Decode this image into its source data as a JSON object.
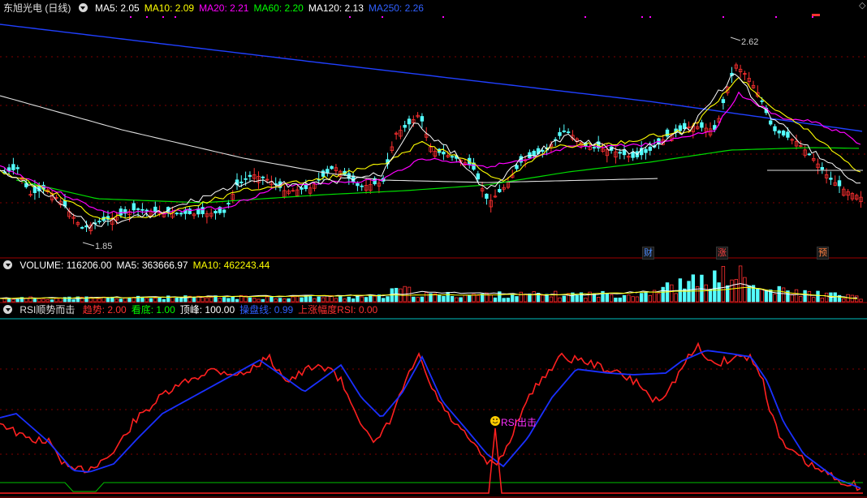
{
  "main_panel": {
    "stock_title": "东旭光电 (日线)",
    "indicators": [
      {
        "label": "MA5: 2.05",
        "color": "#ffffff"
      },
      {
        "label": "MA10: 2.09",
        "color": "#ffff00"
      },
      {
        "label": "MA20: 2.21",
        "color": "#ff00ff"
      },
      {
        "label": "MA60: 2.20",
        "color": "#00ff00"
      },
      {
        "label": "MA120: 2.13",
        "color": "#ffffff"
      },
      {
        "label": "MA250: 2.26",
        "color": "#3060ff"
      }
    ],
    "high_label": "2.62",
    "low_label": "1.85",
    "event_tags": [
      {
        "text": "财",
        "color": "#4a8cff"
      },
      {
        "text": "涨",
        "color": "#ff4040"
      },
      {
        "text": "预",
        "color": "#ff8040"
      }
    ]
  },
  "volume_panel": {
    "indicators": [
      {
        "label": "VOLUME: 116206.00",
        "color": "#ffffff"
      },
      {
        "label": "MA5: 363666.97",
        "color": "#ffffff"
      },
      {
        "label": "MA10: 462243.44",
        "color": "#ffff00"
      }
    ]
  },
  "rsi_panel": {
    "name": "RSI顺势而击",
    "indicators": [
      {
        "label": "趋势: 2.00",
        "color": "#ff3030"
      },
      {
        "label": "看底: 1.00",
        "color": "#00ff00"
      },
      {
        "label": "顶峰: 100.00",
        "color": "#ffffff"
      },
      {
        "label": "操盘线: 0.99",
        "color": "#3060ff"
      },
      {
        "label": "上涨幅度RSI: 0.00",
        "color": "#ff3030"
      }
    ],
    "signal_label": "RSI出击"
  },
  "colors": {
    "up": "#ff3030",
    "down": "#54ffff",
    "grid": "#800000",
    "border": "#a00000"
  }
}
